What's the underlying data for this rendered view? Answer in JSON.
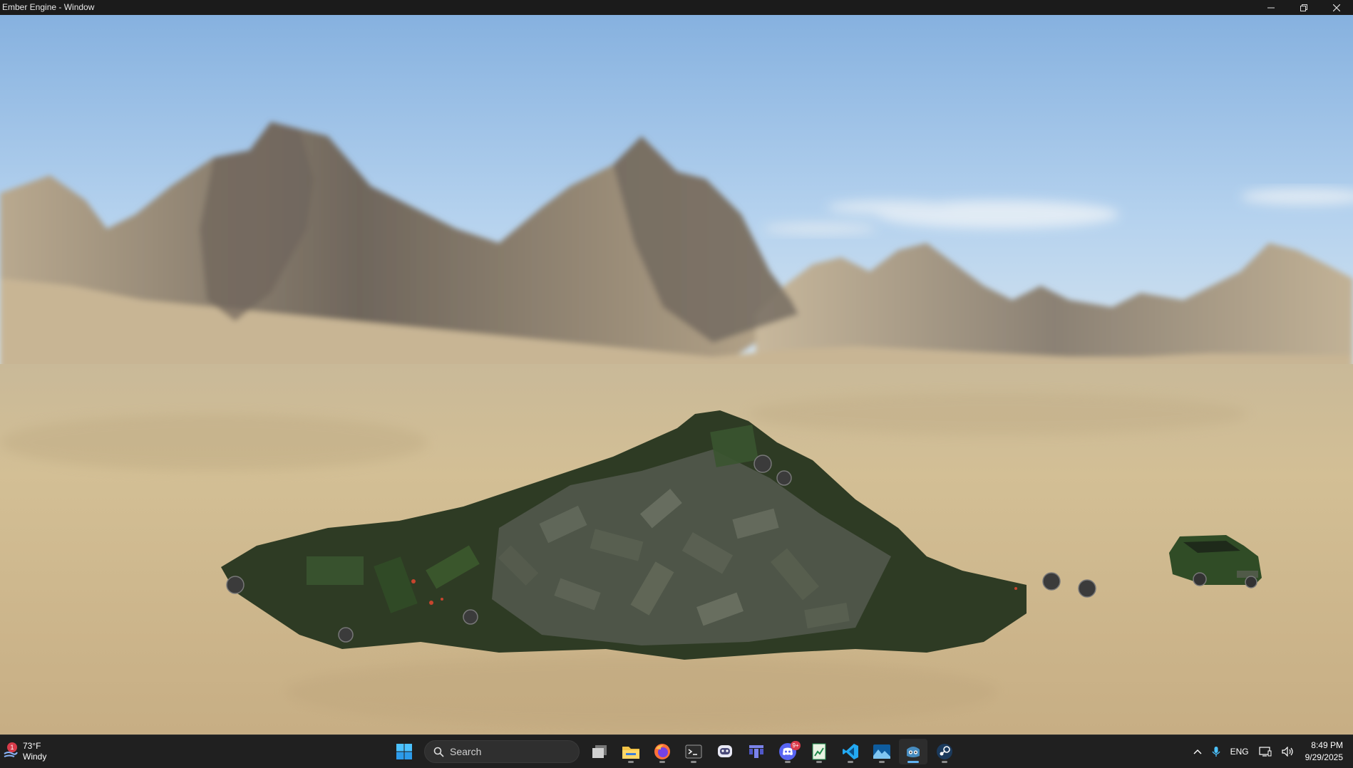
{
  "window": {
    "title": "Ember Engine - Window",
    "controls": [
      "minimize-icon",
      "restore-icon",
      "close-icon"
    ]
  },
  "scene": {
    "sky_top": "#8db7e2",
    "sky_horizon": "#cfe3f2",
    "ground": "#cdb992",
    "mountain": "#9d8e7b",
    "car_color": "#2f4a24"
  },
  "taskbar": {
    "weather": {
      "temp": "73°F",
      "condition": "Windy",
      "badge": "1"
    },
    "search_placeholder": "Search",
    "apps": [
      {
        "name": "start-icon",
        "active": false
      },
      {
        "name": "task-view-icon",
        "active": false
      },
      {
        "name": "file-explorer-icon",
        "active": false
      },
      {
        "name": "firefox-icon",
        "active": false
      },
      {
        "name": "terminal-icon",
        "active": false
      },
      {
        "name": "chat-bot-icon",
        "active": false
      },
      {
        "name": "kanban-icon",
        "active": false
      },
      {
        "name": "discord-icon",
        "active": false,
        "badge": "9+"
      },
      {
        "name": "spreadsheet-icon",
        "active": false
      },
      {
        "name": "vscode-icon",
        "active": false
      },
      {
        "name": "photos-icon",
        "active": false
      },
      {
        "name": "game-engine-icon",
        "active": true
      },
      {
        "name": "steam-icon",
        "active": false
      }
    ],
    "tray": {
      "language": "ENG",
      "time": "8:49 PM",
      "date": "9/29/2025"
    }
  }
}
